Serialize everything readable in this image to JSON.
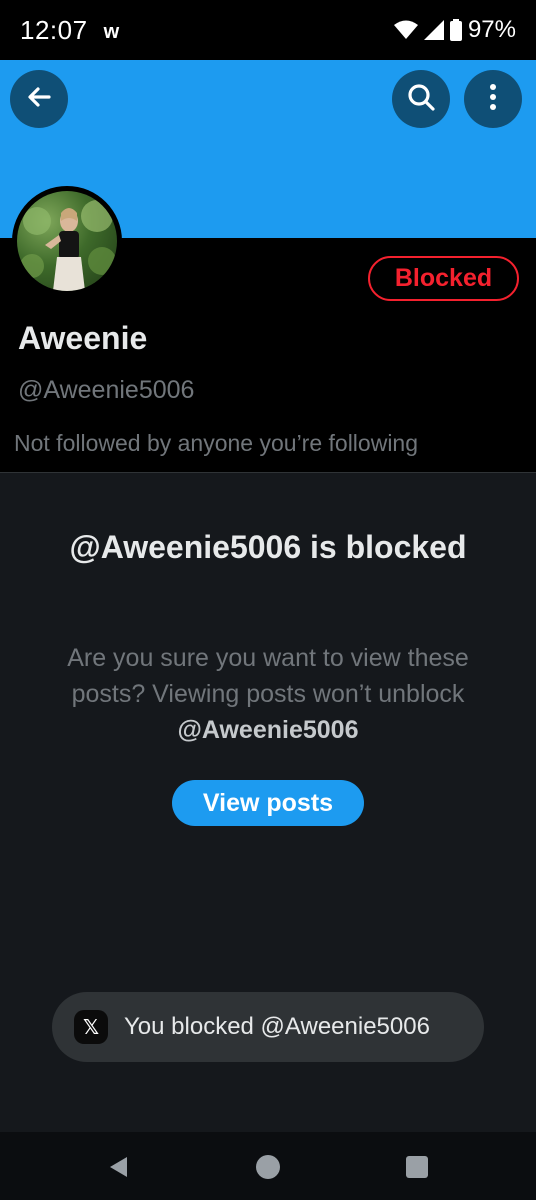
{
  "status_bar": {
    "time": "12:07",
    "notification": "w",
    "battery": "97%"
  },
  "header": {
    "back_icon": "arrow-left-icon",
    "search_icon": "search-icon",
    "more_icon": "more-vertical-icon",
    "banner_color": "#1d9bf0"
  },
  "profile": {
    "display_name": "Aweenie",
    "handle": "@Aweenie5006",
    "followed_by": "Not followed by anyone you’re following",
    "blocked_label": "Blocked"
  },
  "blocked_notice": {
    "title": "@Aweenie5006 is blocked",
    "description_prefix": "Are you sure you want to view these posts? Viewing posts won’t unblock ",
    "description_handle": "@Aweenie5006",
    "view_posts_label": "View posts"
  },
  "toast": {
    "icon": "x-logo-icon",
    "message": "You blocked @Aweenie5006"
  },
  "colors": {
    "accent": "#1d9bf0",
    "blocked_red": "#f4212e",
    "background": "#15181c"
  }
}
